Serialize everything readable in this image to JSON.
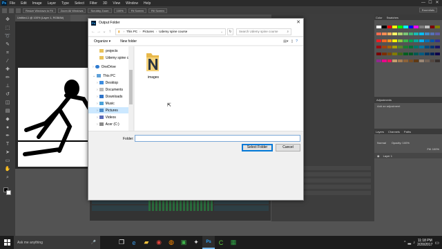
{
  "app": {
    "logo": "Ps",
    "menu": [
      "File",
      "Edit",
      "Image",
      "Layer",
      "Type",
      "Select",
      "Filter",
      "3D",
      "View",
      "Window",
      "Help"
    ],
    "window_controls": [
      "—",
      "☐",
      "✕"
    ],
    "options_bar": [
      "Resize Windows to Fit",
      "Zoom All Windows",
      "Scrubby Zoom",
      "100%",
      "Fit Screen",
      "Fill Screen"
    ],
    "workspace": "Essentials"
  },
  "document_tab": "Untitled-1 @ 100% (Layer 1, RGB/8#)",
  "right_panels": {
    "top_tabs": [
      "Color",
      "Swatches"
    ],
    "adjustments_title": "Adjustments",
    "adjustments_hint": "Add an adjustment",
    "layers_tabs": [
      "Layers",
      "Channels",
      "Paths"
    ],
    "blend_mode": "Normal",
    "opacity": "Opacity: 100%",
    "fill": "Fill: 100%",
    "layer_name": "Layer 1",
    "swatch_colors": [
      "#ffffff",
      "#000000",
      "#ff0000",
      "#ffff00",
      "#00ff00",
      "#00ffff",
      "#0000ff",
      "#ff00ff",
      "#808080",
      "#c0c0c0",
      "#800000",
      "#808000",
      "#f26c4f",
      "#f68e55",
      "#fbaf5c",
      "#fff467",
      "#acd372",
      "#7cc576",
      "#3bb878",
      "#1abbb4",
      "#00bff3",
      "#438cca",
      "#5574b9",
      "#605ca8",
      "#ed1c24",
      "#f26522",
      "#f7941d",
      "#fff200",
      "#8dc63f",
      "#39b54a",
      "#00a651",
      "#00a99d",
      "#00aeef",
      "#0072bc",
      "#0054a6",
      "#2e3192",
      "#9e0b0f",
      "#a0410d",
      "#a36209",
      "#aba000",
      "#598527",
      "#1a7b30",
      "#007236",
      "#00746b",
      "#0076a3",
      "#004b80",
      "#003471",
      "#1b1464",
      "#790000",
      "#7b2e00",
      "#7d4900",
      "#827b00",
      "#406618",
      "#005e20",
      "#005826",
      "#005952",
      "#005b7f",
      "#003663",
      "#002157",
      "#0d004c",
      "#92278f",
      "#ec008c",
      "#ed145b",
      "#c69c6d",
      "#a67c52",
      "#8c6239",
      "#754c24",
      "#603913",
      "#998675",
      "#736357",
      "#534741",
      "#362f2d"
    ]
  },
  "dialog": {
    "title": "Output Folder",
    "close": "✕",
    "breadcrumb": [
      "This PC",
      "Pictures",
      "Udemy spine course"
    ],
    "search_placeholder": "Search Udemy spine course",
    "organize": "Organize ▾",
    "new_folder": "New folder",
    "nav_items": [
      {
        "label": "projects",
        "type": "folder",
        "indent": 1
      },
      {
        "label": "Udemy spine cou",
        "type": "folder",
        "indent": 1
      },
      {
        "label": "OneDrive",
        "type": "cloud",
        "indent": 0
      },
      {
        "label": "This PC",
        "type": "pc",
        "indent": 0
      },
      {
        "label": "Desktop",
        "type": "desktop",
        "indent": 1
      },
      {
        "label": "Documents",
        "type": "docs",
        "indent": 1
      },
      {
        "label": "Downloads",
        "type": "download",
        "indent": 1
      },
      {
        "label": "Music",
        "type": "music",
        "indent": 1
      },
      {
        "label": "Pictures",
        "type": "pictures",
        "indent": 1,
        "selected": true
      },
      {
        "label": "Videos",
        "type": "videos",
        "indent": 1
      },
      {
        "label": "Acer (C:)",
        "type": "drive",
        "indent": 1
      }
    ],
    "files": [
      {
        "name": "images",
        "type": "folder"
      }
    ],
    "folder_label": "Folder:",
    "folder_value": "",
    "select_button": "Select Folder",
    "cancel_button": "Cancel"
  },
  "taskbar": {
    "search_placeholder": "Ask me anything",
    "time": "11:18 PM",
    "date": "2/20/2017",
    "apps": [
      {
        "name": "task-view",
        "glyph": "❐",
        "color": "#ffffff"
      },
      {
        "name": "edge",
        "glyph": "e",
        "color": "#3c9be6"
      },
      {
        "name": "file-explorer",
        "glyph": "▰",
        "color": "#f3c33d"
      },
      {
        "name": "chrome",
        "glyph": "◉",
        "color": "#e0443b"
      },
      {
        "name": "firefox",
        "glyph": "◍",
        "color": "#ff8a00"
      },
      {
        "name": "app-green",
        "glyph": "▣",
        "color": "#3fb24a"
      },
      {
        "name": "spine",
        "glyph": "✦",
        "color": "#dddddd"
      },
      {
        "name": "photoshop",
        "glyph": "Ps",
        "color": "#31a8ff"
      },
      {
        "name": "camtasia",
        "glyph": "C",
        "color": "#5cc83b"
      },
      {
        "name": "app-green-2",
        "glyph": "▦",
        "color": "#2ea043"
      }
    ]
  }
}
